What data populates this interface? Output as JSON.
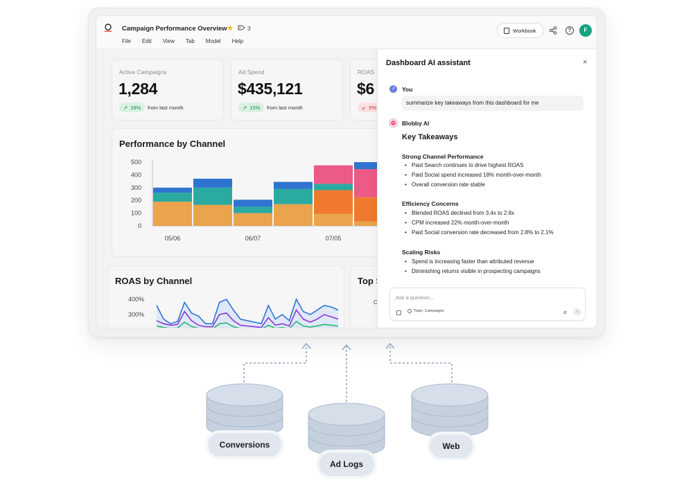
{
  "header": {
    "title": "Campaign Performance Overview",
    "tag_count": "3",
    "menu": [
      "File",
      "Edit",
      "View",
      "Tab",
      "Model",
      "Help"
    ],
    "workbook_label": "Workbook",
    "avatar_initial": "F"
  },
  "kpis": [
    {
      "label": "Active Campaigns",
      "value": "1,284",
      "change": "18%",
      "direction": "up",
      "sub": "from last month"
    },
    {
      "label": "Ad Spend",
      "value": "$435,121",
      "change": "15%",
      "direction": "up",
      "sub": "from last month"
    },
    {
      "label": "ROAS",
      "value": "$6",
      "change": "5%",
      "direction": "down",
      "sub": ""
    }
  ],
  "performance_chart": {
    "title": "Performance by Channel"
  },
  "roas_chart": {
    "title": "ROAS by Channel"
  },
  "top_card": {
    "title": "Top S",
    "fragment": "C"
  },
  "ai_panel": {
    "title": "Dashboard AI assistant",
    "close": "×",
    "user_name": "You",
    "user_avatar": "J",
    "user_message": "summarize key takeaways from this dashboard for me",
    "bot_name": "Blobby AI",
    "heading": "Key Takeaways",
    "sections": [
      {
        "title": "Strong Channel Performance",
        "bullets": [
          "Paid Search continues to drive highest ROAS",
          "Paid Social spend increased 18% month-over-month",
          "Overall conversion rate stable"
        ]
      },
      {
        "title": "Efficiency Concerns",
        "bullets": [
          "Blended ROAS declined from 3.4x to 2.8x",
          "CPM increased 22% month-over-month",
          "Paid Social conversion rate decreased from 2.8% to 2.1%"
        ]
      },
      {
        "title": "Scaling Risks",
        "bullets": [
          "Spend is increasing faster than attributed revenue",
          "Diminishing returns visible in prospecting campaigns"
        ]
      }
    ],
    "input_placeholder": "Ask a question...",
    "topic": "Topic: Campaigns"
  },
  "sources": [
    {
      "label": "Conversions"
    },
    {
      "label": "Ad Logs"
    },
    {
      "label": "Web"
    }
  ],
  "colors": {
    "orange": "#e9a44c",
    "teal": "#2aaaa0",
    "blue": "#2f74d0",
    "pink": "#ec5a86",
    "deep_orange": "#ef7a2e",
    "purple": "#8a36d4",
    "green": "#2bb673",
    "accent_green": "#14a37f",
    "db_fill": "#c7d3e1"
  },
  "chart_data": [
    {
      "type": "bar",
      "title": "Performance by Channel",
      "stacked": true,
      "categories": [
        "05/06",
        "",
        "06/07",
        "",
        "07/05",
        ""
      ],
      "tick_labels_x": [
        "05/06",
        "06/07",
        "07/05"
      ],
      "ylim": [
        0,
        500
      ],
      "yticks": [
        0,
        100,
        200,
        300,
        400,
        500
      ],
      "series": [
        {
          "color": "#e9a44c",
          "values": [
            190,
            165,
            100,
            170,
            95,
            35
          ]
        },
        {
          "color": "#2aaaa0",
          "values": [
            70,
            135,
            50,
            120,
            0,
            0
          ]
        },
        {
          "color": "#ef7a2e",
          "values": [
            0,
            0,
            0,
            0,
            185,
            190
          ]
        },
        {
          "color": "#2aaaa0",
          "values": [
            0,
            0,
            0,
            0,
            50,
            0
          ]
        },
        {
          "color": "#ec5a86",
          "values": [
            0,
            0,
            0,
            0,
            145,
            220
          ]
        },
        {
          "color": "#2f74d0",
          "values": [
            40,
            70,
            55,
            55,
            0,
            55
          ]
        }
      ],
      "grid": false
    },
    {
      "type": "line",
      "title": "ROAS by Channel",
      "ylim": [
        200,
        400
      ],
      "yticks_labels": [
        "400%",
        "300%"
      ],
      "series": [
        {
          "color": "#2f74d0",
          "values": [
            360,
            270,
            240,
            255,
            380,
            310,
            290,
            240,
            240,
            380,
            400,
            330,
            270,
            260,
            250,
            240,
            360,
            270,
            300,
            260,
            400,
            320,
            300,
            330,
            360,
            350,
            330
          ]
        },
        {
          "color": "#8a36d4",
          "values": [
            260,
            240,
            230,
            235,
            320,
            260,
            230,
            220,
            220,
            300,
            310,
            260,
            230,
            225,
            220,
            215,
            280,
            230,
            240,
            225,
            330,
            270,
            250,
            270,
            300,
            285,
            270
          ]
        },
        {
          "color": "#2bb673",
          "values": [
            225,
            215,
            210,
            212,
            250,
            222,
            210,
            205,
            205,
            240,
            245,
            220,
            210,
            207,
            205,
            203,
            230,
            210,
            215,
            207,
            255,
            225,
            218,
            226,
            235,
            230,
            224
          ]
        }
      ]
    }
  ]
}
